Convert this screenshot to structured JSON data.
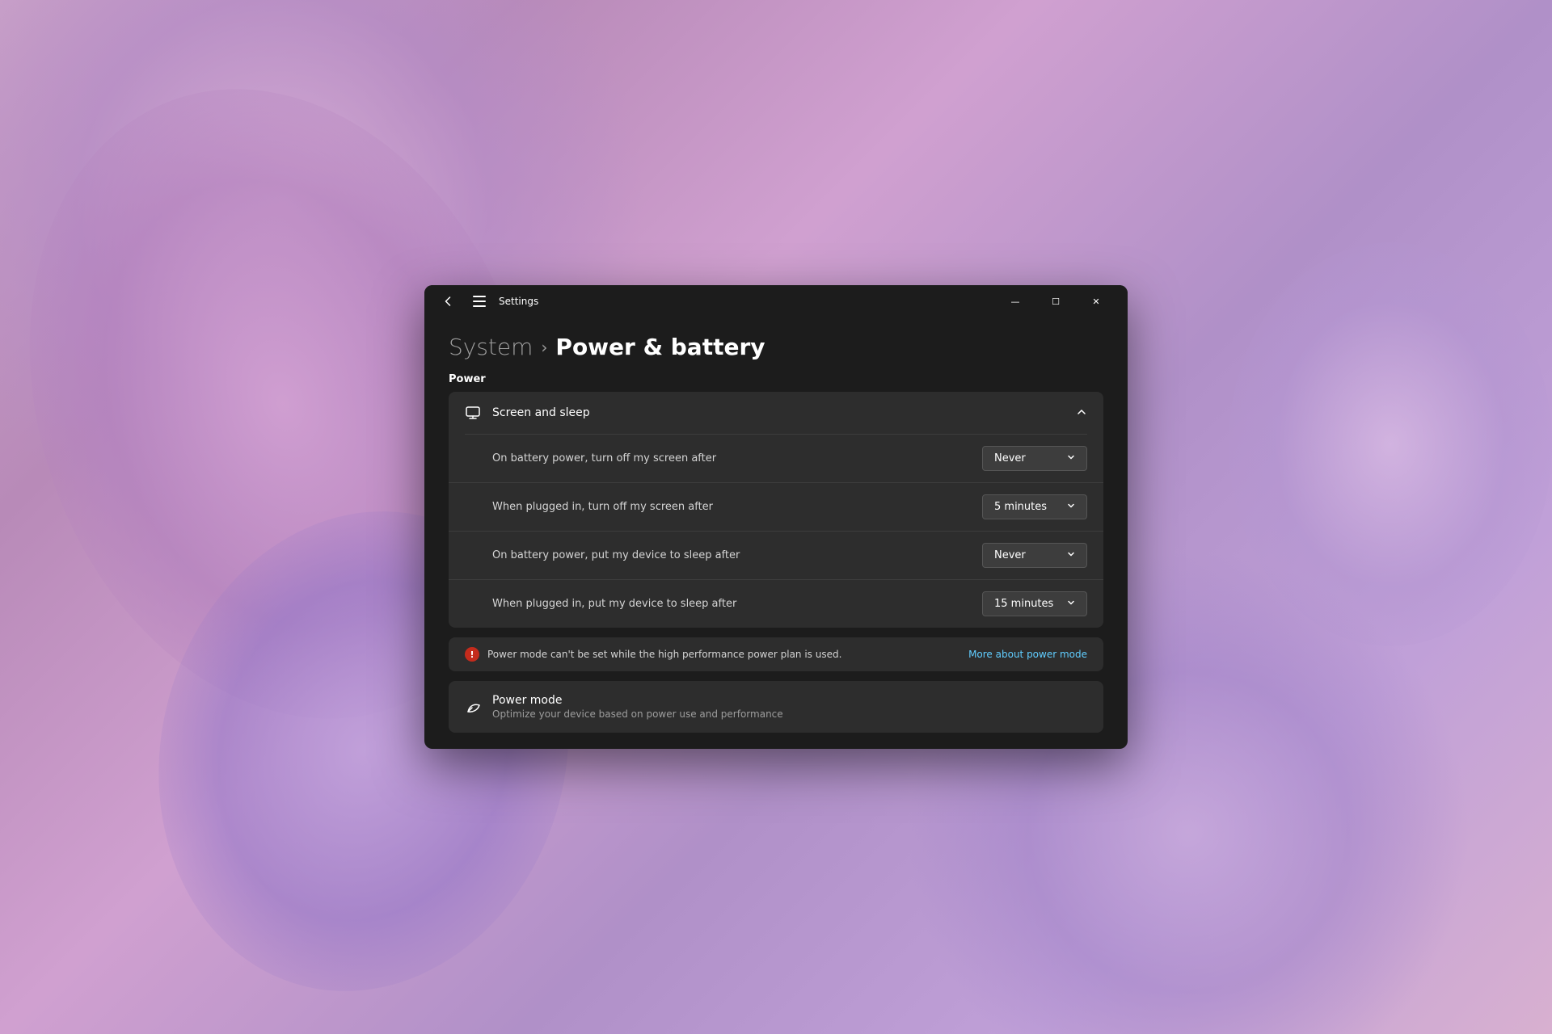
{
  "wallpaper": {
    "alt": "Windows 11 purple wallpaper"
  },
  "window": {
    "title": "Settings",
    "titlebar": {
      "back_label": "‹",
      "menu_label": "☰",
      "title": "Settings",
      "minimize": "—",
      "maximize": "☐",
      "close": "✕"
    }
  },
  "breadcrumb": {
    "parent": "System",
    "chevron": "›",
    "current": "Power & battery"
  },
  "power_section": {
    "label": "Power"
  },
  "screen_and_sleep": {
    "title": "Screen and sleep",
    "chevron": "∧",
    "settings": [
      {
        "label": "On battery power, turn off my screen after",
        "value": "Never"
      },
      {
        "label": "When plugged in, turn off my screen after",
        "value": "5 minutes"
      },
      {
        "label": "On battery power, put my device to sleep after",
        "value": "Never"
      },
      {
        "label": "When plugged in, put my device to sleep after",
        "value": "15 minutes"
      }
    ]
  },
  "warning": {
    "text": "Power mode can't be set while the high performance power plan is used.",
    "link": "More about power mode"
  },
  "power_mode": {
    "title": "Power mode",
    "description": "Optimize your device based on power use and performance"
  }
}
